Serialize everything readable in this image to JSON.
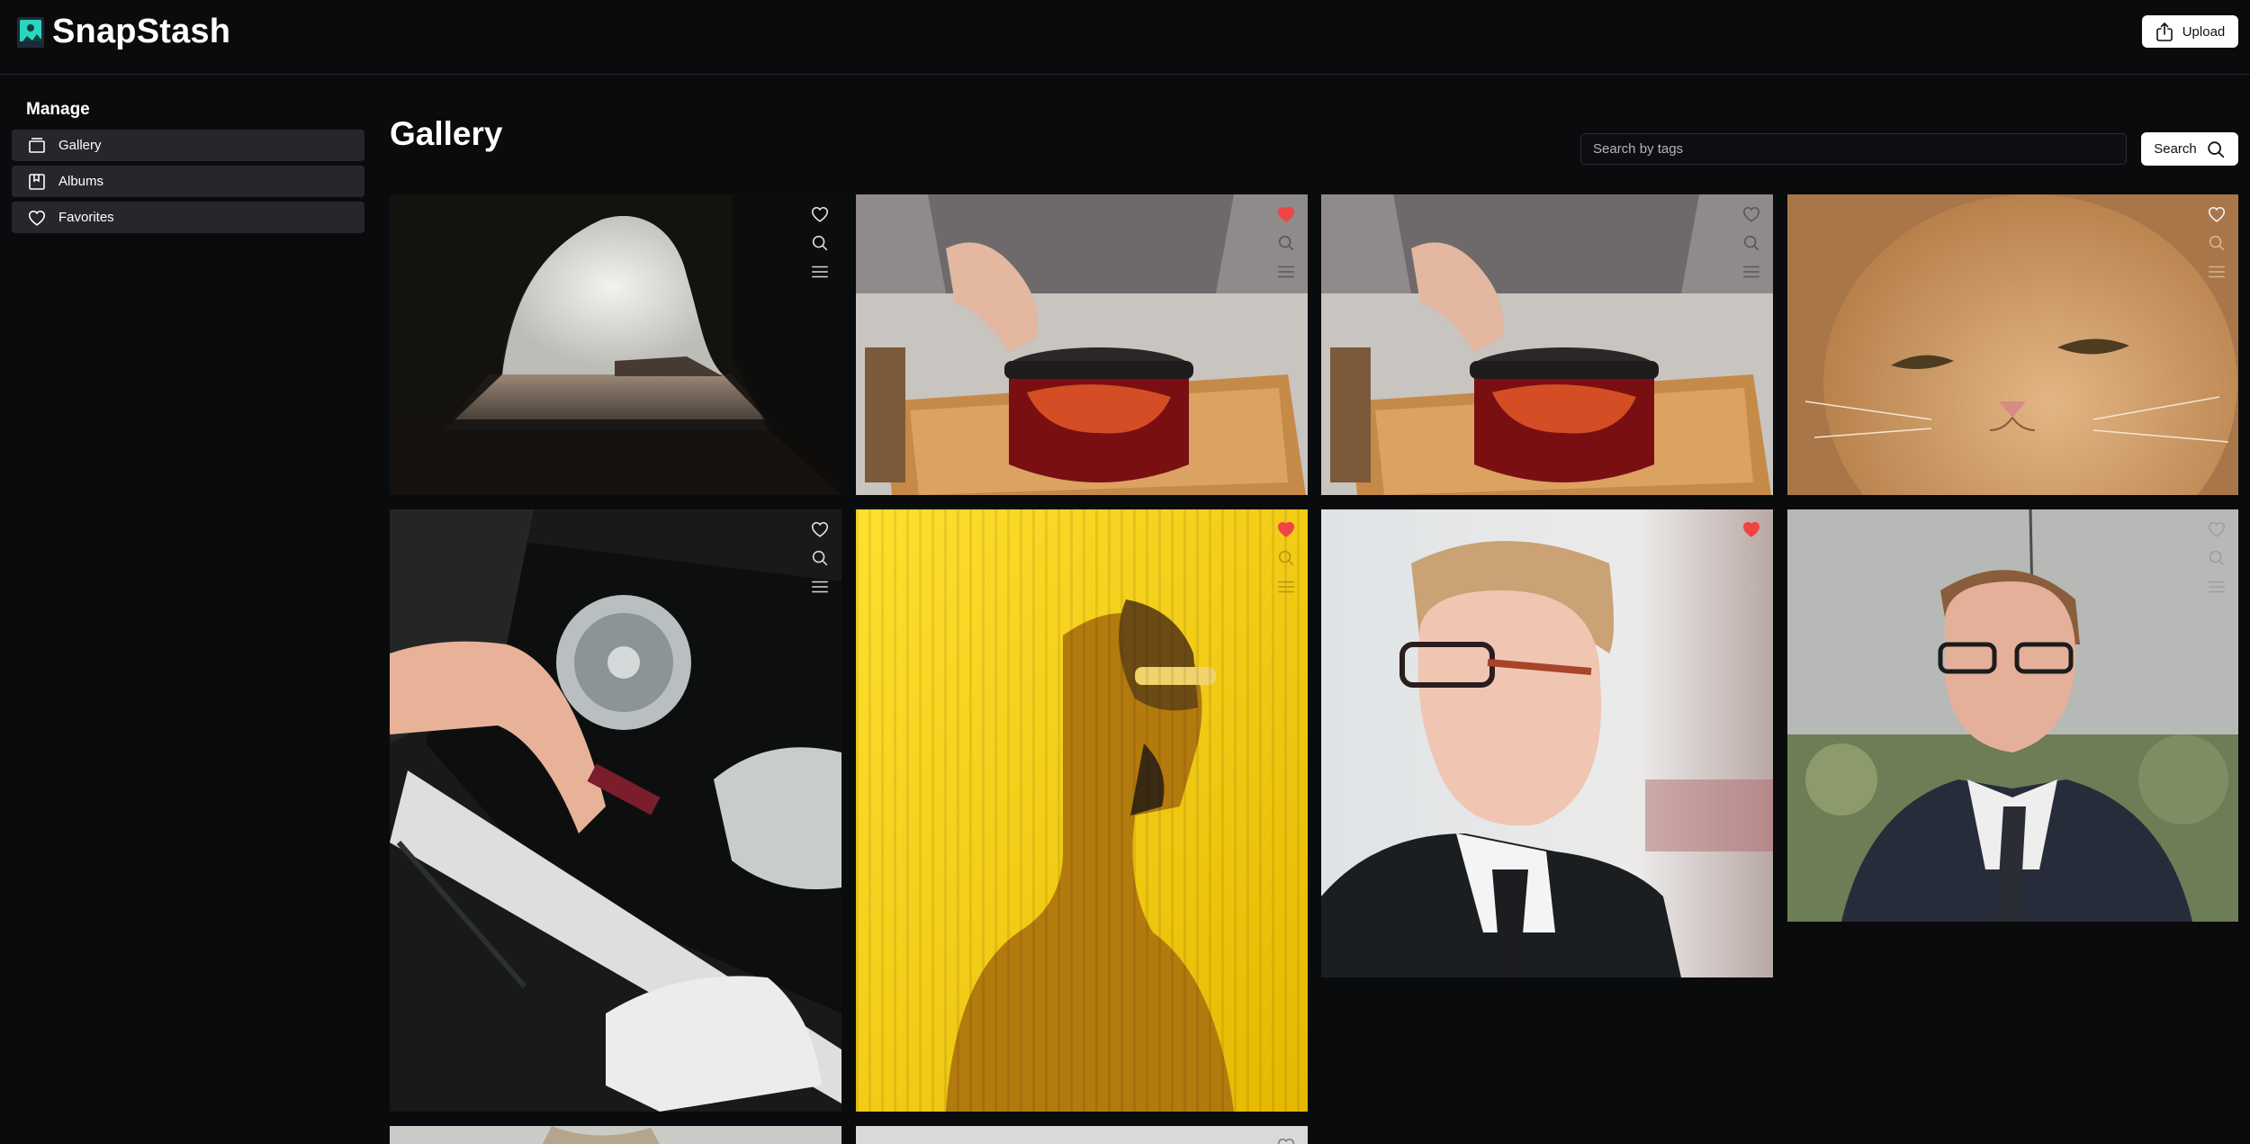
{
  "app": {
    "name": "SnapStash",
    "upload_label": "Upload"
  },
  "sidebar": {
    "heading": "Manage",
    "items": [
      {
        "label": "Gallery",
        "icon": "gallery-icon"
      },
      {
        "label": "Albums",
        "icon": "album-icon"
      },
      {
        "label": "Favorites",
        "icon": "heart-icon"
      }
    ]
  },
  "main": {
    "title": "Gallery",
    "search": {
      "placeholder": "Search by tags",
      "value": "",
      "button_label": "Search"
    }
  },
  "photos": [
    {
      "subject": "cave-beach",
      "favorite": false
    },
    {
      "subject": "teapot",
      "favorite": true
    },
    {
      "subject": "teapot",
      "favorite": false
    },
    {
      "subject": "cat",
      "favorite": false
    },
    {
      "subject": "console-repair",
      "favorite": false
    },
    {
      "subject": "yellow-portrait",
      "favorite": true
    },
    {
      "subject": "man-glasses",
      "favorite": true
    },
    {
      "subject": "man-suit",
      "favorite": false
    },
    {
      "subject": "partial-light",
      "favorite": false
    },
    {
      "subject": "partial-light",
      "favorite": false
    }
  ],
  "colors": {
    "background": "#0a0b0d",
    "sidebar_item_bg": "#26272b",
    "favorite_active": "#ef4444",
    "button_bg": "#ffffff",
    "logo_accent": "#2dd4bf"
  }
}
